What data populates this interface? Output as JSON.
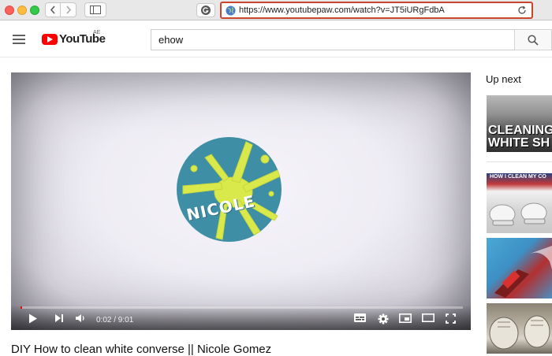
{
  "browser": {
    "url": "https://www.youtubepaw.com/watch?v=JT5iURgFdbA",
    "colors": {
      "url_highlight": "#c9462d"
    }
  },
  "header": {
    "logo_text": "YouTube",
    "logo_region": "AE",
    "search_value": "ehow",
    "icons": [
      "hamburger-icon",
      "search-icon"
    ]
  },
  "player": {
    "overlay_text": "NICOLE",
    "time_display": "0:02 / 9:01",
    "progress_fraction": 0.004,
    "icons": [
      "play-icon",
      "next-icon",
      "volume-icon",
      "subtitles-icon",
      "settings-icon",
      "miniplayer-icon",
      "theater-icon",
      "fullscreen-icon"
    ]
  },
  "video": {
    "title": "DIY How to clean white converse || Nicole Gomez"
  },
  "sidebar": {
    "heading": "Up next",
    "thumbnails": [
      {
        "overlay_text": "CLEANING\nWHITE SH"
      },
      {
        "overlay_text": "HOW I CLEAN MY CO"
      },
      {
        "overlay_text": ""
      },
      {
        "overlay_text": ""
      }
    ]
  }
}
